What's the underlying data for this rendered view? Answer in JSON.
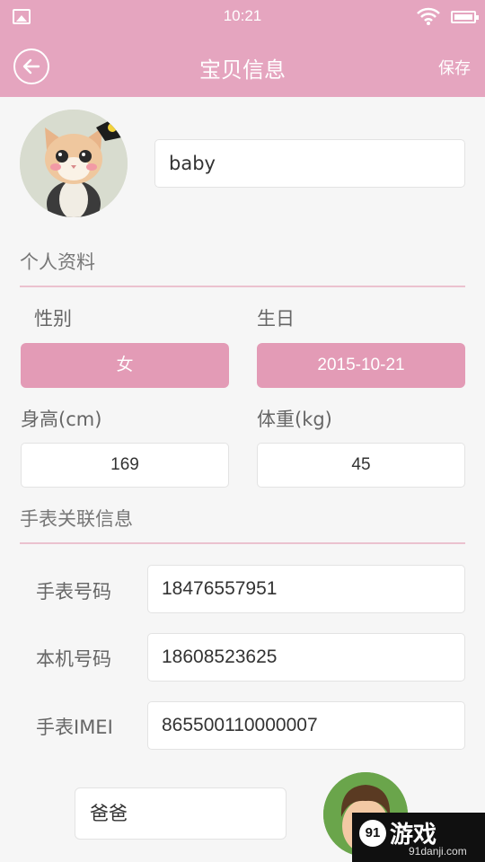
{
  "status_bar": {
    "time": "10:21"
  },
  "header": {
    "title": "宝贝信息",
    "save_label": "保存"
  },
  "profile": {
    "name": "baby"
  },
  "personal": {
    "section_title": "个人资料",
    "gender_label": "性别",
    "gender_value": "女",
    "birthday_label": "生日",
    "birthday_value": "2015-10-21",
    "height_label": "身高(cm)",
    "height_value": "169",
    "weight_label": "体重(kg)",
    "weight_value": "45"
  },
  "watch": {
    "section_title": "手表关联信息",
    "fields": [
      {
        "label": "手表号码",
        "value": "18476557951"
      },
      {
        "label": "本机号码",
        "value": "18608523625"
      },
      {
        "label": "手表IMEI",
        "value": "865500110000007"
      }
    ]
  },
  "contact": {
    "relation": "爸爸"
  },
  "watermark": {
    "brand": "游戏",
    "badge": "91",
    "url": "91danji.com"
  },
  "colors": {
    "primary": "#e5a5bf",
    "button": "#e39bb6",
    "divider": "#ebc2cf"
  }
}
